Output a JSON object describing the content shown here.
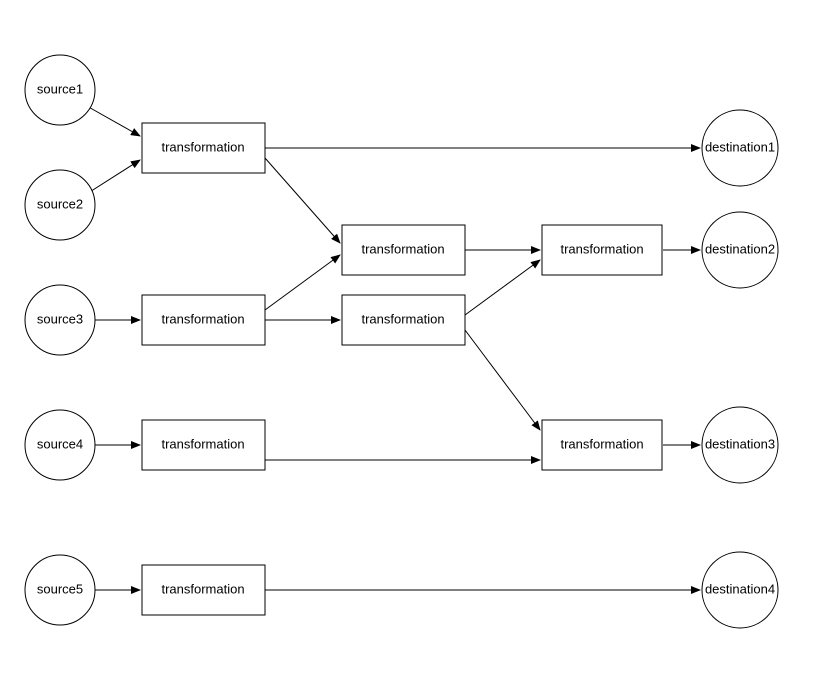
{
  "nodes": {
    "source1": {
      "label": "source1"
    },
    "source2": {
      "label": "source2"
    },
    "source3": {
      "label": "source3"
    },
    "source4": {
      "label": "source4"
    },
    "source5": {
      "label": "source5"
    },
    "t1": {
      "label": "transformation"
    },
    "t2": {
      "label": "transformation"
    },
    "t3": {
      "label": "transformation"
    },
    "t4": {
      "label": "transformation"
    },
    "t5": {
      "label": "transformation"
    },
    "t6": {
      "label": "transformation"
    },
    "t7": {
      "label": "transformation"
    },
    "destination1": {
      "label": "destination1"
    },
    "destination2": {
      "label": "destination2"
    },
    "destination3": {
      "label": "destination3"
    },
    "destination4": {
      "label": "destination4"
    }
  }
}
